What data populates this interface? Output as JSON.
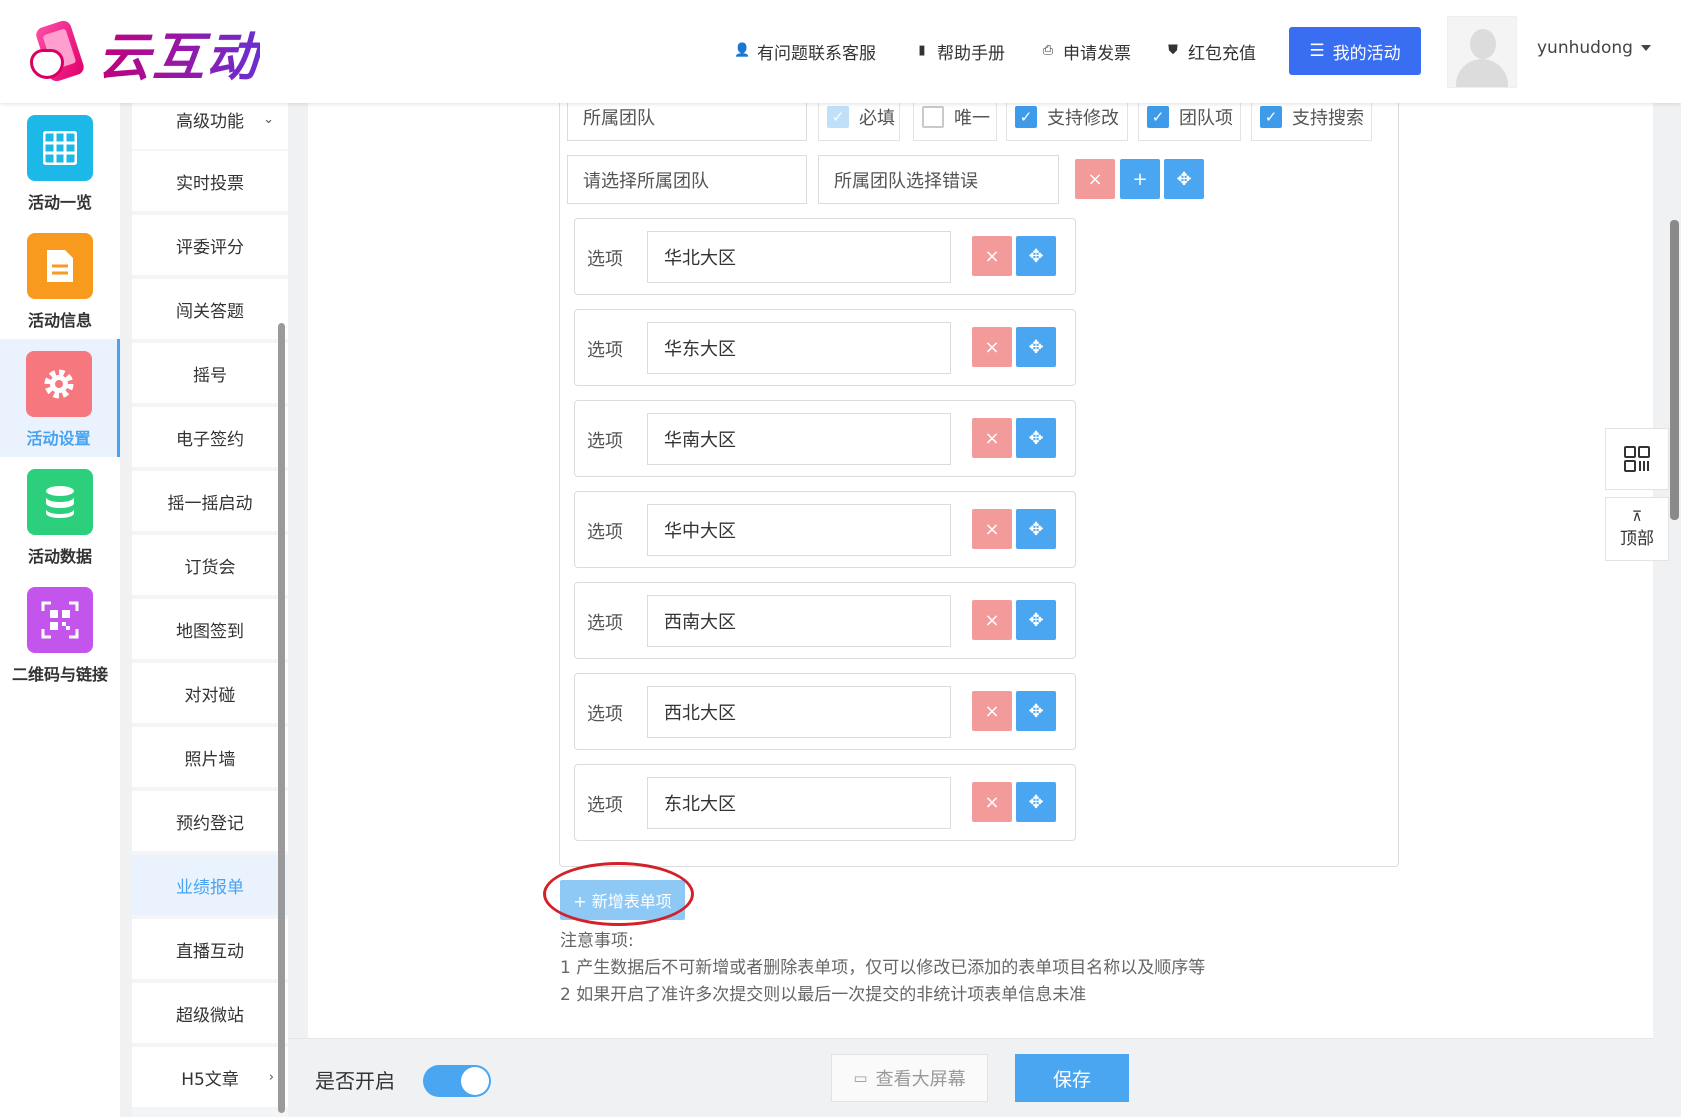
{
  "header": {
    "logo_text": "云互动",
    "nav": [
      {
        "label": "有问题联系客服",
        "icon": "user-plus-icon"
      },
      {
        "label": "帮助手册",
        "icon": "book-icon"
      },
      {
        "label": "申请发票",
        "icon": "printer-icon"
      },
      {
        "label": "红包充值",
        "icon": "shield-check-icon"
      }
    ],
    "my_activity": "我的活动",
    "username": "yunhudong"
  },
  "iconbar": [
    {
      "label": "活动一览",
      "icon": "grid-icon",
      "color": "#1cb9e8"
    },
    {
      "label": "活动信息",
      "icon": "document-icon",
      "color": "#f79a1e"
    },
    {
      "label": "活动设置",
      "icon": "gear-icon",
      "color": "#f6777d",
      "active": true
    },
    {
      "label": "活动数据",
      "icon": "database-icon",
      "color": "#2bcf7c"
    },
    {
      "label": "二维码与链接",
      "icon": "qrcode-icon",
      "color": "#c455ec"
    }
  ],
  "submenu": [
    {
      "label": "高级功能",
      "arrow": "⌄"
    },
    {
      "label": "实时投票"
    },
    {
      "label": "评委评分"
    },
    {
      "label": "闯关答题"
    },
    {
      "label": "摇号"
    },
    {
      "label": "电子签约"
    },
    {
      "label": "摇一摇启动"
    },
    {
      "label": "订货会"
    },
    {
      "label": "地图签到"
    },
    {
      "label": "对对碰"
    },
    {
      "label": "照片墙"
    },
    {
      "label": "预约登记"
    },
    {
      "label": "业绩报单",
      "active": true
    },
    {
      "label": "直播互动"
    },
    {
      "label": "超级微站"
    },
    {
      "label": "H5文章",
      "arrow": "›"
    }
  ],
  "form": {
    "field_name": "所属团队",
    "checkboxes": [
      {
        "label": "必填",
        "state": "dim"
      },
      {
        "label": "唯一",
        "state": "off"
      },
      {
        "label": "支持修改",
        "state": "on"
      },
      {
        "label": "团队项",
        "state": "on"
      },
      {
        "label": "支持搜索",
        "state": "on"
      }
    ],
    "placeholder_value": "请选择所属团队",
    "error_value": "所属团队选择错误",
    "option_label": "选项",
    "options": [
      "华北大区",
      "华东大区",
      "华南大区",
      "华中大区",
      "西南大区",
      "西北大区",
      "东北大区"
    ],
    "add_button": "+ 新增表单项",
    "notes_title": "注意事项:",
    "notes": [
      "1 产生数据后不可新增或者删除表单项，仅可以修改已添加的表单项目名称以及顺序等",
      "2 如果开启了准许多次提交则以最后一次提交的非统计项表单信息未准"
    ]
  },
  "footer": {
    "enable_label": "是否开启",
    "enabled": true,
    "view_screen": "查看大屏幕",
    "save": "保存"
  },
  "floating": {
    "top_label": "顶部"
  }
}
